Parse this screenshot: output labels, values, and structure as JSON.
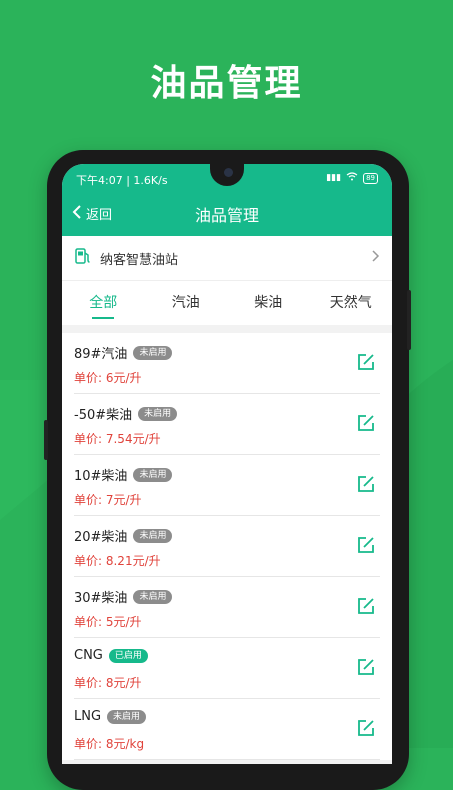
{
  "headline": "油品管理",
  "status_bar": {
    "time_speed": "下午4:07 | 1.6K/s",
    "battery": "89"
  },
  "nav": {
    "back_label": "返回",
    "title": "油品管理"
  },
  "station": {
    "name": "纳客智慧油站"
  },
  "tabs": [
    {
      "label": "全部",
      "active": true
    },
    {
      "label": "汽油",
      "active": false
    },
    {
      "label": "柴油",
      "active": false
    },
    {
      "label": "天然气",
      "active": false
    }
  ],
  "price_prefix": "单价: ",
  "items": [
    {
      "name": "89#汽油",
      "status": "未启用",
      "price": "单价: 6元/升"
    },
    {
      "name": "-50#柴油",
      "status": "未启用",
      "price": "单价: 7.54元/升"
    },
    {
      "name": "10#柴油",
      "status": "未启用",
      "price": "单价: 7元/升"
    },
    {
      "name": "20#柴油",
      "status": "未启用",
      "price": "单价: 8.21元/升"
    },
    {
      "name": "30#柴油",
      "status": "未启用",
      "price": "单价: 5元/升"
    },
    {
      "name": "CNG",
      "status": "已启用",
      "price": "单价: 8元/升"
    },
    {
      "name": "LNG",
      "status": "未启用",
      "price": "单价: 8元/kg"
    }
  ],
  "colors": {
    "brand": "#16b98b",
    "background": "#2bb35a",
    "price": "#e0433b",
    "badge_off": "#8c8c8c"
  }
}
